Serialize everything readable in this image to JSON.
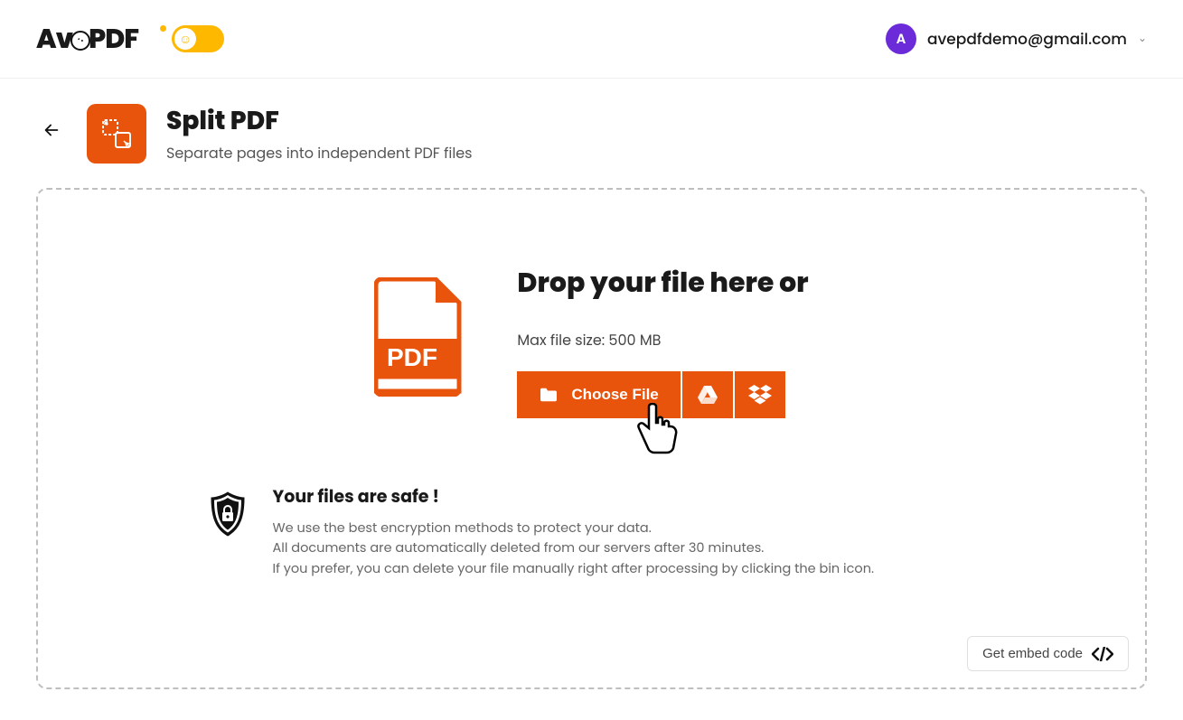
{
  "header": {
    "logo_pre": "Av",
    "logo_post": "PDF",
    "avatar_initial": "A",
    "user_email": "avepdfdemo@gmail.com"
  },
  "page": {
    "title": "Split PDF",
    "subtitle": "Separate pages into independent PDF files"
  },
  "dropzone": {
    "heading": "Drop your file here or",
    "max_size": "Max file size: 500 MB",
    "choose_label": "Choose File",
    "pdf_badge": "PDF"
  },
  "safe": {
    "heading": "Your files are safe !",
    "line1": "We use the best encryption methods to protect your data.",
    "line2": "All documents are automatically deleted from our servers after 30 minutes.",
    "line3": "If you prefer, you can delete your file manually right after processing by clicking the bin icon."
  },
  "embed": {
    "label": "Get embed code"
  },
  "colors": {
    "brand_orange": "#E9540D",
    "accent_yellow": "#FFB800",
    "avatar_purple": "#6B2BD9"
  }
}
